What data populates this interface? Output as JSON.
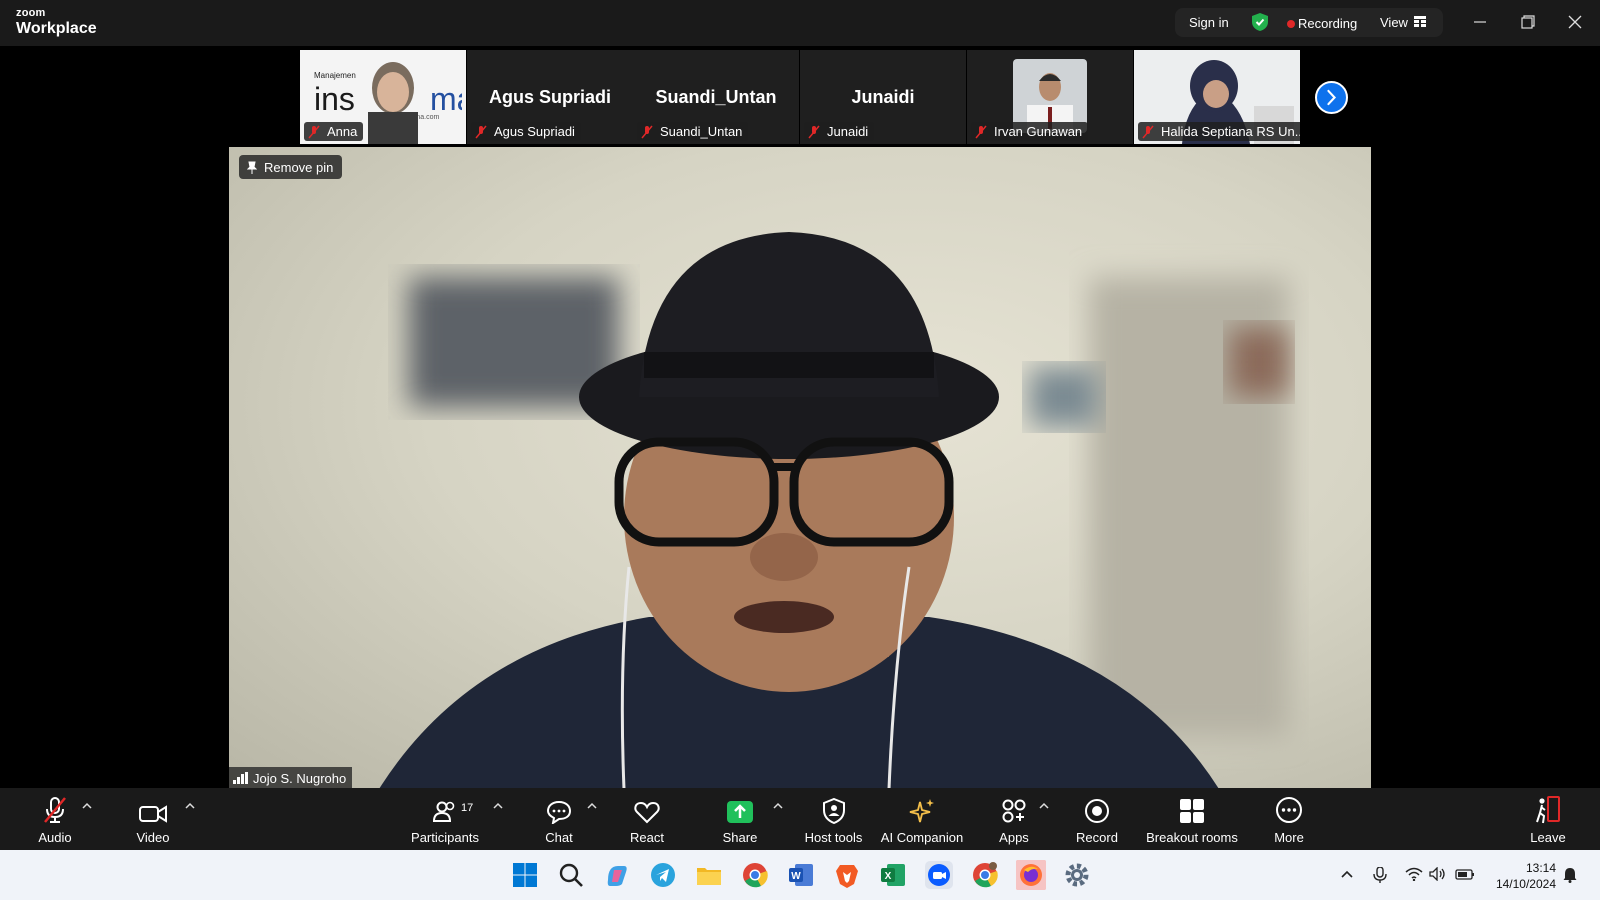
{
  "app": {
    "brand_small": "zoom",
    "brand_big": "Workplace"
  },
  "topbar": {
    "signin": "Sign in",
    "recording": "Recording",
    "view": "View"
  },
  "thumbnails": [
    {
      "name": "Anna",
      "logo_text": "Manajemen",
      "logo_url": "insinma.com"
    },
    {
      "name": "Agus Supriadi",
      "big": "Agus Supriadi"
    },
    {
      "name": "Suandi_Untan",
      "big": "Suandi_Untan"
    },
    {
      "name": "Junaidi",
      "big": "Junaidi"
    },
    {
      "name": "Irvan Gunawan"
    },
    {
      "name": "Halida Septiana RS Un..."
    }
  ],
  "main": {
    "remove_pin": "Remove pin",
    "speaker": "Jojo S. Nugroho"
  },
  "toolbar": {
    "audio": "Audio",
    "video": "Video",
    "participants": "Participants",
    "participant_count": "17",
    "chat": "Chat",
    "react": "React",
    "share": "Share",
    "host_tools": "Host tools",
    "ai_companion": "AI Companion",
    "apps": "Apps",
    "record": "Record",
    "breakout": "Breakout rooms",
    "more": "More",
    "leave": "Leave"
  },
  "taskbar": {
    "time": "13:14",
    "date": "14/10/2024"
  },
  "colors": {
    "accent": "#0e72ed",
    "recording": "#e02828",
    "share": "#20c05b",
    "mute": "#e02828"
  }
}
